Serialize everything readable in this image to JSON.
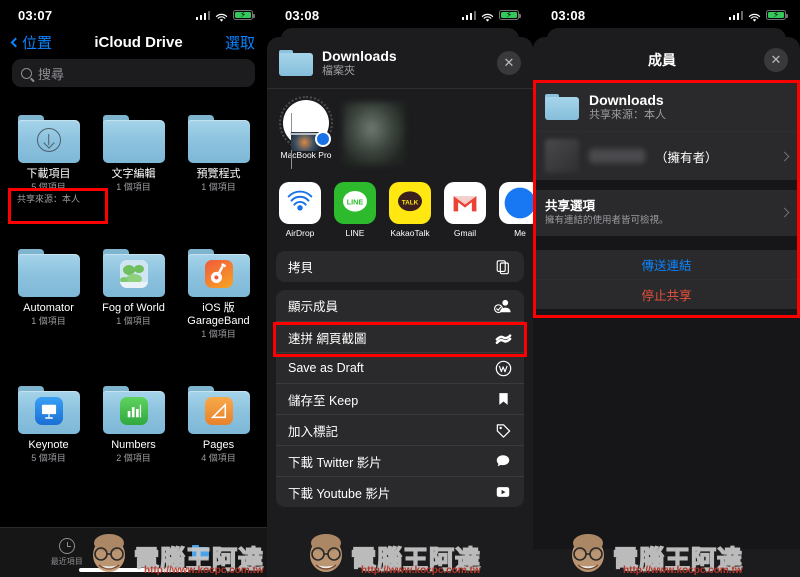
{
  "panel1": {
    "statusbar": {
      "time": "03:07",
      "signal_icon": "cellular-bars-icon",
      "wifi_icon": "wifi-icon",
      "battery_icon": "battery-charging-icon"
    },
    "nav": {
      "back_label": "位置",
      "title": "iCloud Drive",
      "right_label": "選取"
    },
    "search": {
      "placeholder": "搜尋",
      "icon": "search-icon"
    },
    "folders": [
      {
        "name": "下載項目",
        "sub": "5 個項目",
        "shared": "共享來源：本人",
        "icon": "download-folder-icon",
        "highlighted": true
      },
      {
        "name": "文字編輯",
        "sub": "1 個項目",
        "icon": "folder-icon"
      },
      {
        "name": "預覽程式",
        "sub": "1 個項目",
        "icon": "folder-icon"
      },
      {
        "name": "Automator",
        "sub": "1 個項目",
        "icon": "folder-icon"
      },
      {
        "name": "Fog of World",
        "sub": "1 個項目",
        "icon": "fog-of-world-app-icon"
      },
      {
        "name": "iOS 版 GarageBand",
        "sub": "1 個項目",
        "icon": "garageband-app-icon"
      },
      {
        "name": "Keynote",
        "sub": "5 個項目",
        "icon": "keynote-app-icon"
      },
      {
        "name": "Numbers",
        "sub": "2 個項目",
        "icon": "numbers-app-icon"
      },
      {
        "name": "Pages",
        "sub": "4 個項目",
        "icon": "pages-app-icon"
      }
    ],
    "tabbar": [
      {
        "label": "最近項目",
        "icon": "clock-icon"
      },
      {
        "label": "",
        "icon": "browse-folder-icon"
      }
    ]
  },
  "panel2": {
    "statusbar": {
      "time": "03:08"
    },
    "header": {
      "title": "Downloads",
      "subtitle": "檔案夾",
      "close_icon": "close-icon",
      "folder_icon": "folder-icon"
    },
    "airdrop": [
      {
        "name": "MacBook Pro",
        "icon": "macbook-pro-airdrop-icon"
      }
    ],
    "apps": [
      {
        "name": "AirDrop",
        "icon": "airdrop-icon"
      },
      {
        "name": "LINE",
        "icon": "line-app-icon"
      },
      {
        "name": "KakaoTalk",
        "icon": "kakaotalk-app-icon"
      },
      {
        "name": "Gmail",
        "icon": "gmail-app-icon"
      },
      {
        "name": "Me",
        "icon": "messenger-app-icon"
      }
    ],
    "actions_top": [
      {
        "label": "拷貝",
        "icon": "copy-icon"
      }
    ],
    "actions": [
      {
        "label": "顯示成員",
        "icon": "show-people-icon",
        "highlighted": true
      },
      {
        "label": "速拼 網頁截圖",
        "icon": "picsew-icon"
      },
      {
        "label": "Save as Draft",
        "icon": "wordpress-icon"
      },
      {
        "label": "儲存至 Keep",
        "icon": "keep-bookmark-icon"
      },
      {
        "label": "加入標記",
        "icon": "tag-icon"
      },
      {
        "label": "下載 Twitter 影片",
        "icon": "speech-bubble-icon"
      },
      {
        "label": "下載 Youtube 影片",
        "icon": "play-badge-icon"
      }
    ]
  },
  "panel3": {
    "statusbar": {
      "time": "03:08"
    },
    "header": {
      "title": "成員",
      "close_icon": "close-icon"
    },
    "file": {
      "name": "Downloads",
      "sub": "共享來源：本人",
      "icon": "folder-icon"
    },
    "owner_row": {
      "label": "（擁有者）",
      "avatar": "blurred-avatar",
      "chevron": "chevron-right-icon"
    },
    "share_options": {
      "title": "共享選項",
      "subtitle": "擁有連結的使用者皆可檢視。",
      "chevron": "chevron-right-icon"
    },
    "buttons": [
      {
        "label": "傳送連結",
        "color": "#0a84ff"
      },
      {
        "label": "停止共享",
        "color": "#e8503a"
      }
    ]
  },
  "watermark": {
    "text": "電腦王阿達",
    "url": "http://www.kocpc.com.tw"
  },
  "colors": {
    "accent_blue": "#0a84ff",
    "highlight_red": "#ff0000",
    "destructive": "#e8503a",
    "folder_blue": "#8cc2de"
  }
}
